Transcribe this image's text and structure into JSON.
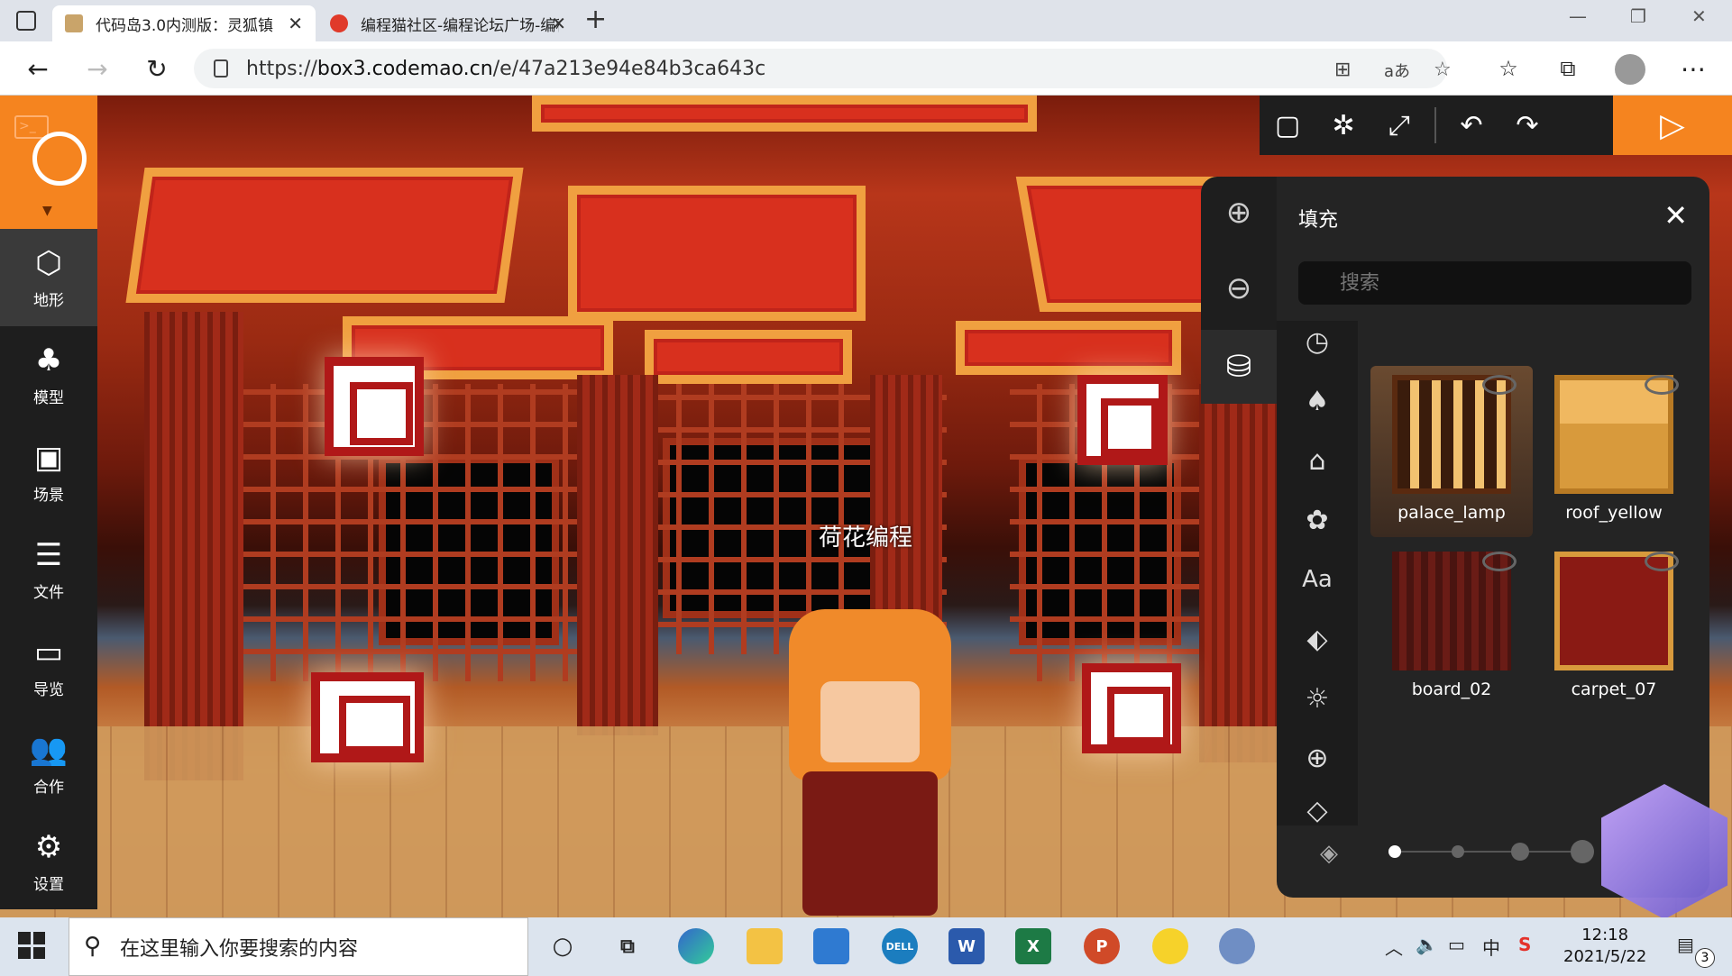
{
  "browser": {
    "tabs": [
      {
        "title": "代码岛3.0内测版：灵狐镇",
        "active": true
      },
      {
        "title": "编程猫社区-编程论坛广场-编程学",
        "active": false
      }
    ],
    "new_tab": "+",
    "url_prefix": "https://",
    "url_host": "box3.codemao.cn",
    "url_path": "/e/47a213e94e84b3ca643c"
  },
  "game": {
    "player_name": "荷花编程"
  },
  "left_toolbar": {
    "items": [
      {
        "label": "地形",
        "icon": "cube-icon"
      },
      {
        "label": "模型",
        "icon": "tree-icon"
      },
      {
        "label": "场景",
        "icon": "image-icon"
      },
      {
        "label": "文件",
        "icon": "file-icon"
      },
      {
        "label": "导览",
        "icon": "folder-icon"
      },
      {
        "label": "合作",
        "icon": "users-icon"
      },
      {
        "label": "设置",
        "icon": "gear-icon"
      }
    ]
  },
  "fill_panel": {
    "title": "填充",
    "search_placeholder": "搜索",
    "blocks": [
      {
        "name": "palace_lamp",
        "selected": true
      },
      {
        "name": "roof_yellow",
        "selected": false
      },
      {
        "name": "board_02",
        "selected": false
      },
      {
        "name": "carpet_07",
        "selected": false
      }
    ],
    "pages": 4,
    "current_page": 1
  },
  "taskbar": {
    "search_placeholder": "在这里输入你要搜索的内容",
    "time": "12:18",
    "date": "2021/5/22",
    "ime": "中",
    "notifications": "3"
  },
  "colors": {
    "accent": "#f5841f",
    "panel": "#242424",
    "toolbar": "#1e1e1e"
  }
}
